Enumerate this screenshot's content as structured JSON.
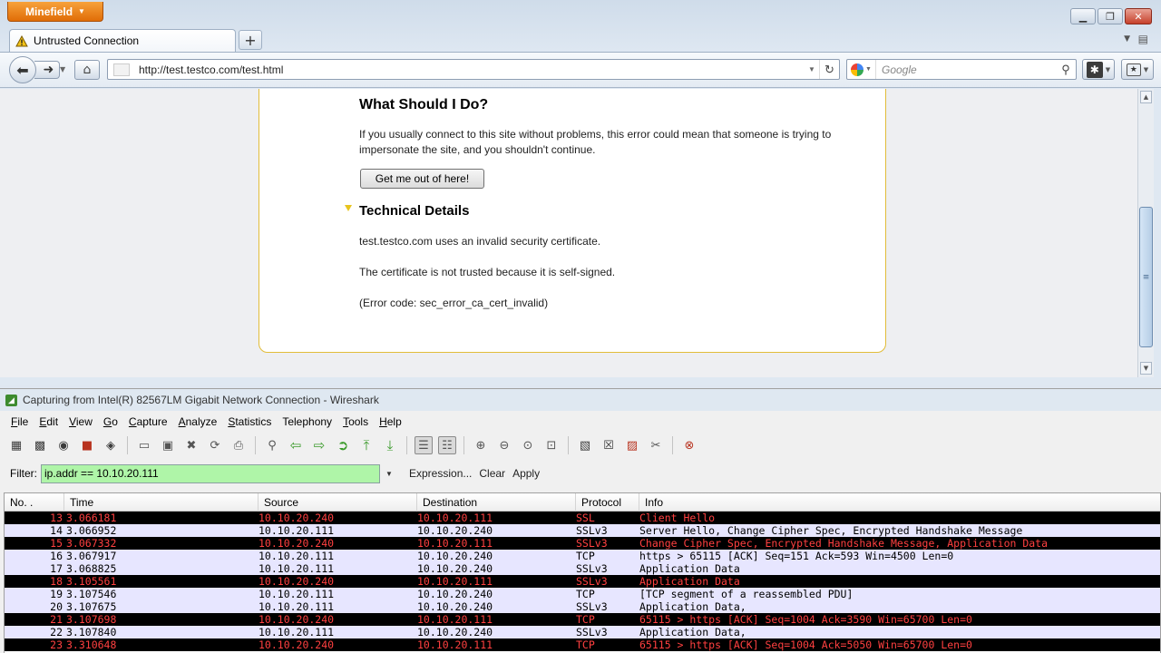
{
  "browser": {
    "app_button": "Minefield",
    "tab_title": "Untrusted Connection",
    "url": "http://test.testco.com/test.html",
    "search_placeholder": "Google",
    "page": {
      "heading": "What Should I Do?",
      "paragraph": "If you usually connect to this site without problems, this error could mean that someone is trying to impersonate the site, and you shouldn't continue.",
      "get_out_label": "Get me out of here!",
      "tech_heading": "Technical Details",
      "tech_lines": [
        "test.testco.com uses an invalid security certificate.",
        "The certificate is not trusted because it is self-signed.",
        "(Error code: sec_error_ca_cert_invalid)"
      ]
    }
  },
  "wireshark": {
    "title": "Capturing from Intel(R) 82567LM Gigabit Network Connection - Wireshark",
    "menu": [
      {
        "u": "F",
        "rest": "ile"
      },
      {
        "u": "E",
        "rest": "dit"
      },
      {
        "u": "V",
        "rest": "iew"
      },
      {
        "u": "G",
        "rest": "o"
      },
      {
        "u": "C",
        "rest": "apture"
      },
      {
        "u": "A",
        "rest": "nalyze"
      },
      {
        "u": "S",
        "rest": "tatistics"
      },
      {
        "u": "",
        "rest": "Telephony"
      },
      {
        "u": "T",
        "rest": "ools"
      },
      {
        "u": "H",
        "rest": "elp"
      }
    ],
    "filter": {
      "label": "Filter:",
      "value": "ip.addr == 10.10.20.111",
      "expression": "Expression...",
      "clear": "Clear",
      "apply": "Apply"
    },
    "columns": [
      "No. .",
      "Time",
      "Source",
      "Destination",
      "Protocol",
      "Info"
    ],
    "packets": [
      {
        "no": "13",
        "time": "3.066181",
        "src": "10.10.20.240",
        "dst": "10.10.20.111",
        "proto": "SSL",
        "info": "Client Hello",
        "style": "bad"
      },
      {
        "no": "14",
        "time": "3.066952",
        "src": "10.10.20.111",
        "dst": "10.10.20.240",
        "proto": "SSLv3",
        "info": "Server Hello, Change Cipher Spec, Encrypted Handshake Message",
        "style": "ssl"
      },
      {
        "no": "15",
        "time": "3.067332",
        "src": "10.10.20.240",
        "dst": "10.10.20.111",
        "proto": "SSLv3",
        "info": "Change Cipher Spec, Encrypted Handshake Message, Application Data",
        "style": "bad"
      },
      {
        "no": "16",
        "time": "3.067917",
        "src": "10.10.20.111",
        "dst": "10.10.20.240",
        "proto": "TCP",
        "info": "https > 65115 [ACK] Seq=151 Ack=593 Win=4500 Len=0",
        "style": "tcp"
      },
      {
        "no": "17",
        "time": "3.068825",
        "src": "10.10.20.111",
        "dst": "10.10.20.240",
        "proto": "SSLv3",
        "info": "Application Data",
        "style": "ssl"
      },
      {
        "no": "18",
        "time": "3.105561",
        "src": "10.10.20.240",
        "dst": "10.10.20.111",
        "proto": "SSLv3",
        "info": "Application Data",
        "style": "bad"
      },
      {
        "no": "19",
        "time": "3.107546",
        "src": "10.10.20.111",
        "dst": "10.10.20.240",
        "proto": "TCP",
        "info": "[TCP segment of a reassembled PDU]",
        "style": "tcp"
      },
      {
        "no": "20",
        "time": "3.107675",
        "src": "10.10.20.111",
        "dst": "10.10.20.240",
        "proto": "SSLv3",
        "info": "Application Data,",
        "style": "ssl"
      },
      {
        "no": "21",
        "time": "3.107698",
        "src": "10.10.20.240",
        "dst": "10.10.20.111",
        "proto": "TCP",
        "info": "65115 > https [ACK] Seq=1004 Ack=3590 Win=65700 Len=0",
        "style": "bad"
      },
      {
        "no": "22",
        "time": "3.107840",
        "src": "10.10.20.111",
        "dst": "10.10.20.240",
        "proto": "SSLv3",
        "info": "Application Data,",
        "style": "ssl"
      },
      {
        "no": "23",
        "time": "3.310648",
        "src": "10.10.20.240",
        "dst": "10.10.20.111",
        "proto": "TCP",
        "info": "65115 > https [ACK] Seq=1004 Ack=5050 Win=65700 Len=0",
        "style": "bad"
      }
    ],
    "row_colors": {
      "bad": {
        "bg": "#000000",
        "fg": "#ff4040"
      },
      "ssl": {
        "bg": "#e7e6ff",
        "fg": "#000000"
      },
      "tcp": {
        "bg": "#e7e6ff",
        "fg": "#000000"
      }
    }
  }
}
